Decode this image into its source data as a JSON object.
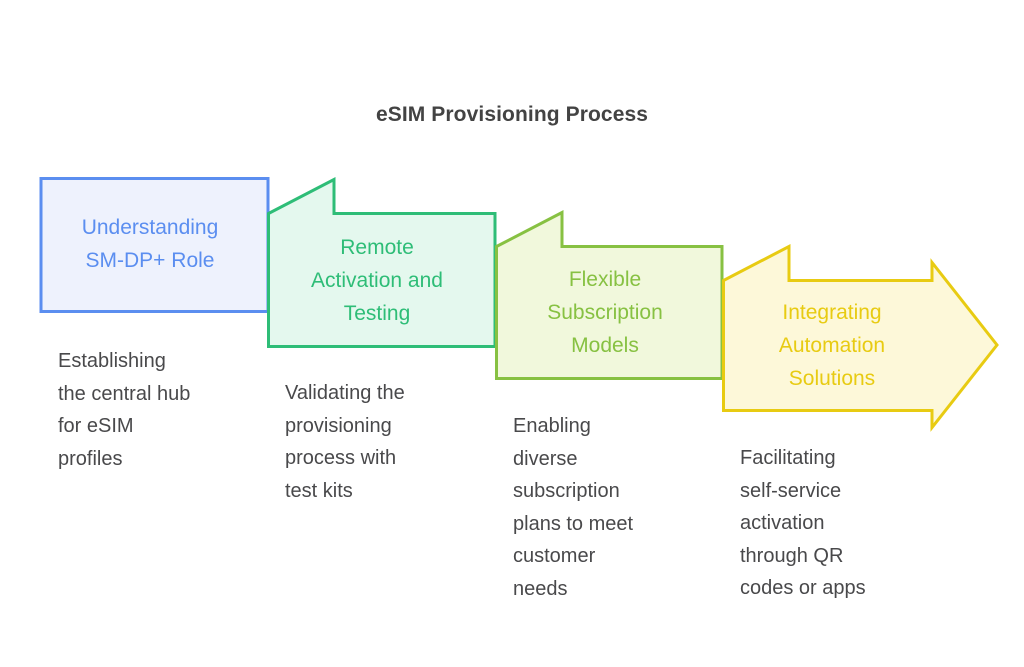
{
  "page": {
    "background": "#ffffff",
    "title": "eSIM Provisioning Process",
    "title_color": "#434343",
    "caption_color": "#49494b"
  },
  "chart_data": {
    "type": "diagram",
    "subtype": "chevron-process-flow",
    "title": "eSIM Provisioning Process",
    "direction": "left-to-right",
    "steps": [
      {
        "index": 1,
        "title": "Understanding\nSM-DP+ Role",
        "caption": "Establishing\nthe central hub\nfor eSIM\nprofiles",
        "stroke": "#5b8ef0",
        "fill": "#eef2fd",
        "shape": "rectangle"
      },
      {
        "index": 2,
        "title": "Remote\nActivation and\nTesting",
        "caption": "Validating the\nprovisioning\nprocess with\ntest kits",
        "stroke": "#2ebd77",
        "fill": "#e4f8ee",
        "shape": "notched-banner"
      },
      {
        "index": 3,
        "title": "Flexible\nSubscription\nModels",
        "caption": "Enabling\ndiverse\nsubscription\nplans to meet\ncustomer\nneeds",
        "stroke": "#87c142",
        "fill": "#f1f8dc",
        "shape": "notched-banner"
      },
      {
        "index": 4,
        "title": "Integrating\nAutomation\nSolutions",
        "caption": "Facilitating\nself-service\nactivation\nthrough QR\ncodes or apps",
        "stroke": "#e8cb12",
        "fill": "#fdf8d9",
        "shape": "notched-arrow"
      }
    ]
  },
  "steps": [
    {
      "title": "Understanding\nSM-DP+ Role",
      "caption": "Establishing\nthe central hub\nfor eSIM\nprofiles"
    },
    {
      "title": "Remote\nActivation and\nTesting",
      "caption": "Validating the\nprovisioning\nprocess with\ntest kits"
    },
    {
      "title": "Flexible\nSubscription\nModels",
      "caption": "Enabling\ndiverse\nsubscription\nplans to meet\ncustomer\nneeds"
    },
    {
      "title": "Integrating\nAutomation\nSolutions",
      "caption": "Facilitating\nself-service\nactivation\nthrough QR\ncodes or apps"
    }
  ]
}
